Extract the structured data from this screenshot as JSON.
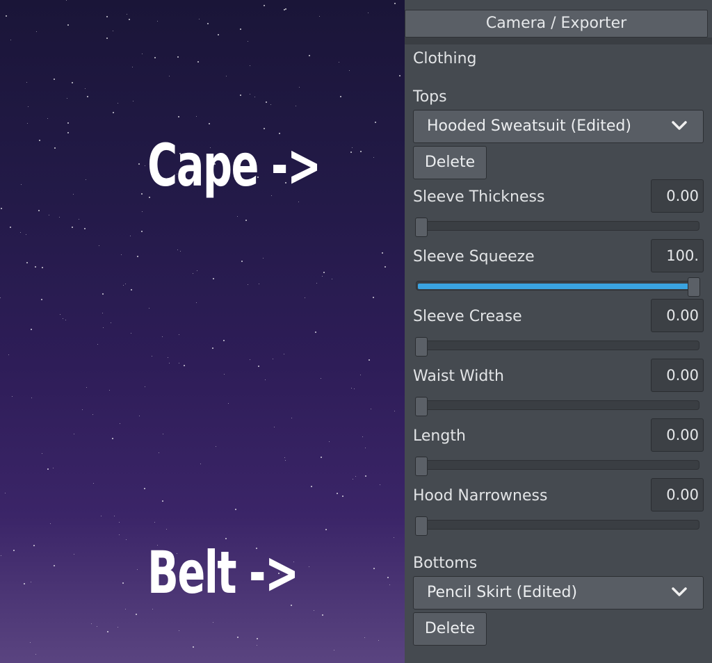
{
  "overlay": {
    "cape": "Cape ->",
    "belt": "Belt ->"
  },
  "panel": {
    "header": "Camera / Exporter",
    "section": "Clothing",
    "tops": {
      "label": "Tops",
      "selected": "Hooded Sweatsuit (Edited)",
      "delete_label": "Delete"
    },
    "sliders": [
      {
        "label": "Sleeve Thickness",
        "value": "0.00",
        "fraction": 0.0
      },
      {
        "label": "Sleeve Squeeze",
        "value": "100.",
        "fraction": 1.0
      },
      {
        "label": "Sleeve Crease",
        "value": "0.00",
        "fraction": 0.0
      },
      {
        "label": "Waist Width",
        "value": "0.00",
        "fraction": 0.0
      },
      {
        "label": "Length",
        "value": "0.00",
        "fraction": 0.0
      },
      {
        "label": "Hood Narrowness",
        "value": "0.00",
        "fraction": 0.0
      }
    ],
    "bottoms": {
      "label": "Bottoms",
      "selected": "Pencil Skirt (Edited)",
      "delete_label": "Delete"
    }
  },
  "colors": {
    "panel_bg": "#454a50",
    "slider_fill": "#3aa3e0",
    "sky_top": "#1a1538",
    "sky_bottom": "#5a4480"
  },
  "icons": {
    "dropdown": "chevron-down-icon"
  }
}
